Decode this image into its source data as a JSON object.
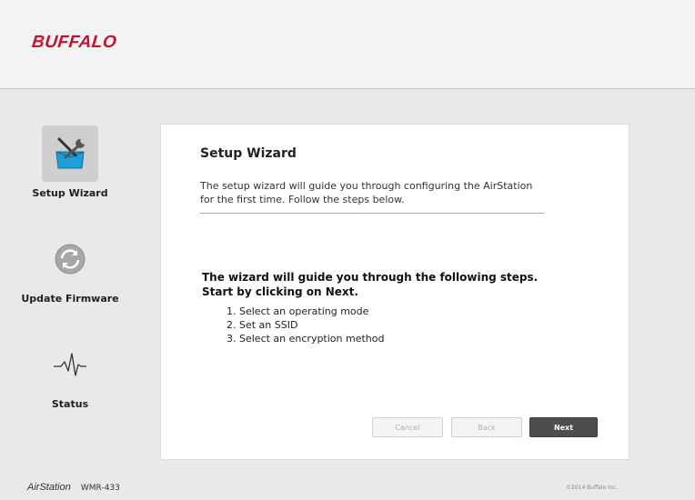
{
  "header": {
    "logo_text": "BUFFALO"
  },
  "sidebar": {
    "items": [
      {
        "label": "Setup Wizard",
        "icon": "toolbox-wrench-icon",
        "active": true
      },
      {
        "label": "Update Firmware",
        "icon": "refresh-icon",
        "active": false
      },
      {
        "label": "Status",
        "icon": "pulse-icon",
        "active": false
      }
    ]
  },
  "wizard": {
    "title": "Setup Wizard",
    "description": "The setup wizard will guide you through configuring the AirStation for the first time. Follow the steps below.",
    "intro_line1": "The wizard will guide you through the following steps.",
    "intro_line2": "Start by clicking on Next.",
    "steps": [
      "1.  Select an operating mode",
      "2.  Set an SSID",
      "3.  Select an encryption method"
    ],
    "buttons": {
      "cancel": "Cancel",
      "back": "Back",
      "next": "Next"
    }
  },
  "footer": {
    "product": "AirStation",
    "model": "WMR-433",
    "copyright": "©2014 Buffalo Inc."
  },
  "colors": {
    "brand": "#c8102e",
    "primary_button": "#4d4d4d",
    "background": "#e9e9e9"
  }
}
